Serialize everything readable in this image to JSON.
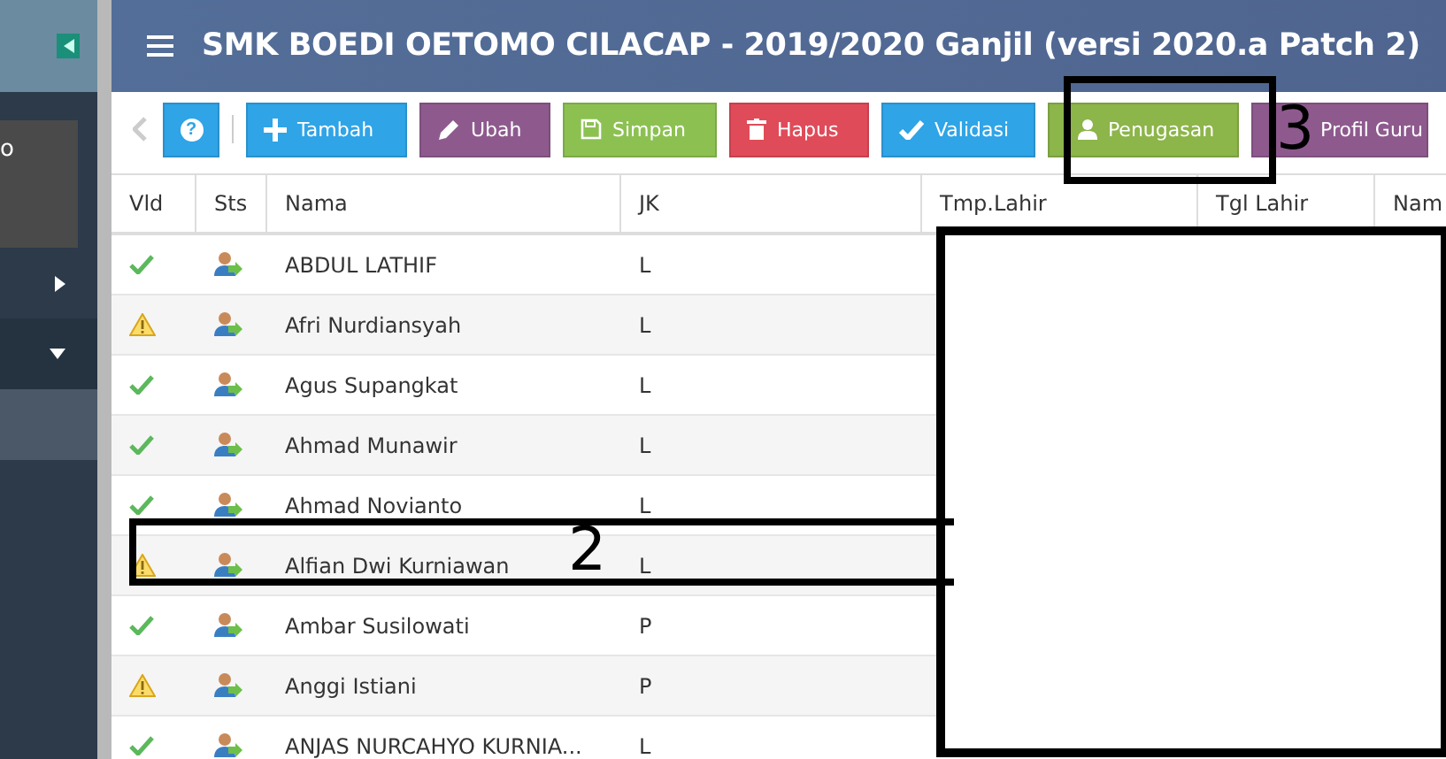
{
  "header": {
    "title": "SMK BOEDI OETOMO CILACAP - 2019/2020 Ganjil (versi 2020.a Patch 2)"
  },
  "sidebar": {
    "panel_text": "o",
    "items": [
      {
        "kind": "collapsed"
      },
      {
        "kind": "expanded"
      },
      {
        "kind": "selected"
      }
    ]
  },
  "toolbar": {
    "help": {
      "label": "?"
    },
    "buttons": [
      {
        "label": "Tambah",
        "kind": "add"
      },
      {
        "label": "Ubah",
        "kind": "edit"
      },
      {
        "label": "Simpan",
        "kind": "save"
      },
      {
        "label": "Hapus",
        "kind": "delete"
      },
      {
        "label": "Validasi",
        "kind": "validate"
      },
      {
        "label": "Penugasan",
        "kind": "assign"
      },
      {
        "label": "Profil Guru",
        "kind": "profile"
      }
    ]
  },
  "table": {
    "columns": [
      "Vld",
      "Sts",
      "Nama",
      "JK",
      "Tmp.Lahir",
      "Tgl Lahir",
      "Nam"
    ],
    "rows": [
      {
        "valid": true,
        "name": "ABDUL LATHIF",
        "jk": "L"
      },
      {
        "valid": false,
        "name": "Afri Nurdiansyah",
        "jk": "L"
      },
      {
        "valid": true,
        "name": "Agus Supangkat",
        "jk": "L"
      },
      {
        "valid": true,
        "name": "Ahmad Munawir",
        "jk": "L"
      },
      {
        "valid": true,
        "name": "Ahmad Novianto",
        "jk": "L"
      },
      {
        "valid": false,
        "name": "Alfian Dwi Kurniawan",
        "jk": "L"
      },
      {
        "valid": true,
        "name": "Ambar Susilowati",
        "jk": "P"
      },
      {
        "valid": false,
        "name": "Anggi Istiani",
        "jk": "P"
      },
      {
        "valid": true,
        "name": "ANJAS NURCAHYO KURNIA...",
        "jk": "L"
      }
    ]
  },
  "annotations": [
    {
      "label": "2"
    },
    {
      "label": "3"
    }
  ]
}
